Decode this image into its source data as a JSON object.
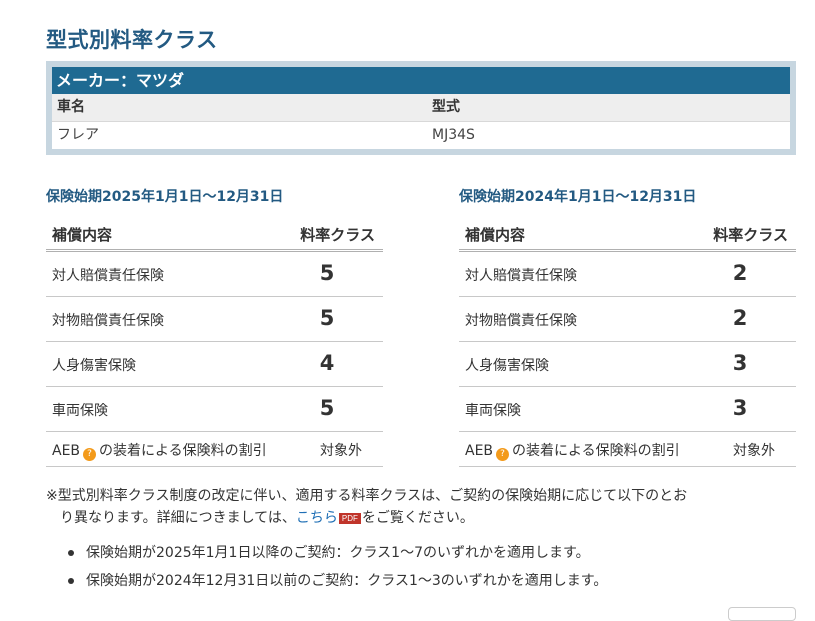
{
  "page_title": "型式別料率クラス",
  "maker": {
    "header": "メーカー：マツダ",
    "col_name_label": "車名",
    "col_model_label": "型式",
    "car_name": "フレア",
    "model": "MJ34S"
  },
  "periods": [
    {
      "title": "保険始期2025年1月1日〜12月31日",
      "col_coverage": "補償内容",
      "col_class": "料率クラス",
      "rows": [
        {
          "label": "対人賠償責任保険",
          "value": "5"
        },
        {
          "label": "対物賠償責任保険",
          "value": "5"
        },
        {
          "label": "人身傷害保険",
          "value": "4"
        },
        {
          "label": "車両保険",
          "value": "5"
        }
      ],
      "aeb": {
        "prefix": "AEB",
        "suffix": "の装着による保険料の割引",
        "value": "対象外"
      }
    },
    {
      "title": "保険始期2024年1月1日〜12月31日",
      "col_coverage": "補償内容",
      "col_class": "料率クラス",
      "rows": [
        {
          "label": "対人賠償責任保険",
          "value": "2"
        },
        {
          "label": "対物賠償責任保険",
          "value": "2"
        },
        {
          "label": "人身傷害保険",
          "value": "3"
        },
        {
          "label": "車両保険",
          "value": "3"
        }
      ],
      "aeb": {
        "prefix": "AEB",
        "suffix": "の装着による保険料の割引",
        "value": "対象外"
      }
    }
  ],
  "note": {
    "line1": "※型式別料率クラス制度の改定に伴い、適用する料率クラスは、ご契約の保険始期に応じて以下のとお",
    "line2_pre": "り異なります。詳細につきましては、",
    "link_text": "こちら",
    "pdf_badge": "PDF",
    "line2_post": "をご覧ください。"
  },
  "bullets": [
    "保険始期が2025年1月1日以降のご契約：クラス1〜7のいずれかを適用します。",
    "保険始期が2024年12月31日以前のご契約：クラス1〜3のいずれかを適用します。"
  ],
  "colors": {
    "title_blue": "#235a82",
    "header_bar": "#1f6a92",
    "link": "#1f6fb5",
    "pdf_red": "#c0342a",
    "aeb_orange": "#f39a1a"
  }
}
